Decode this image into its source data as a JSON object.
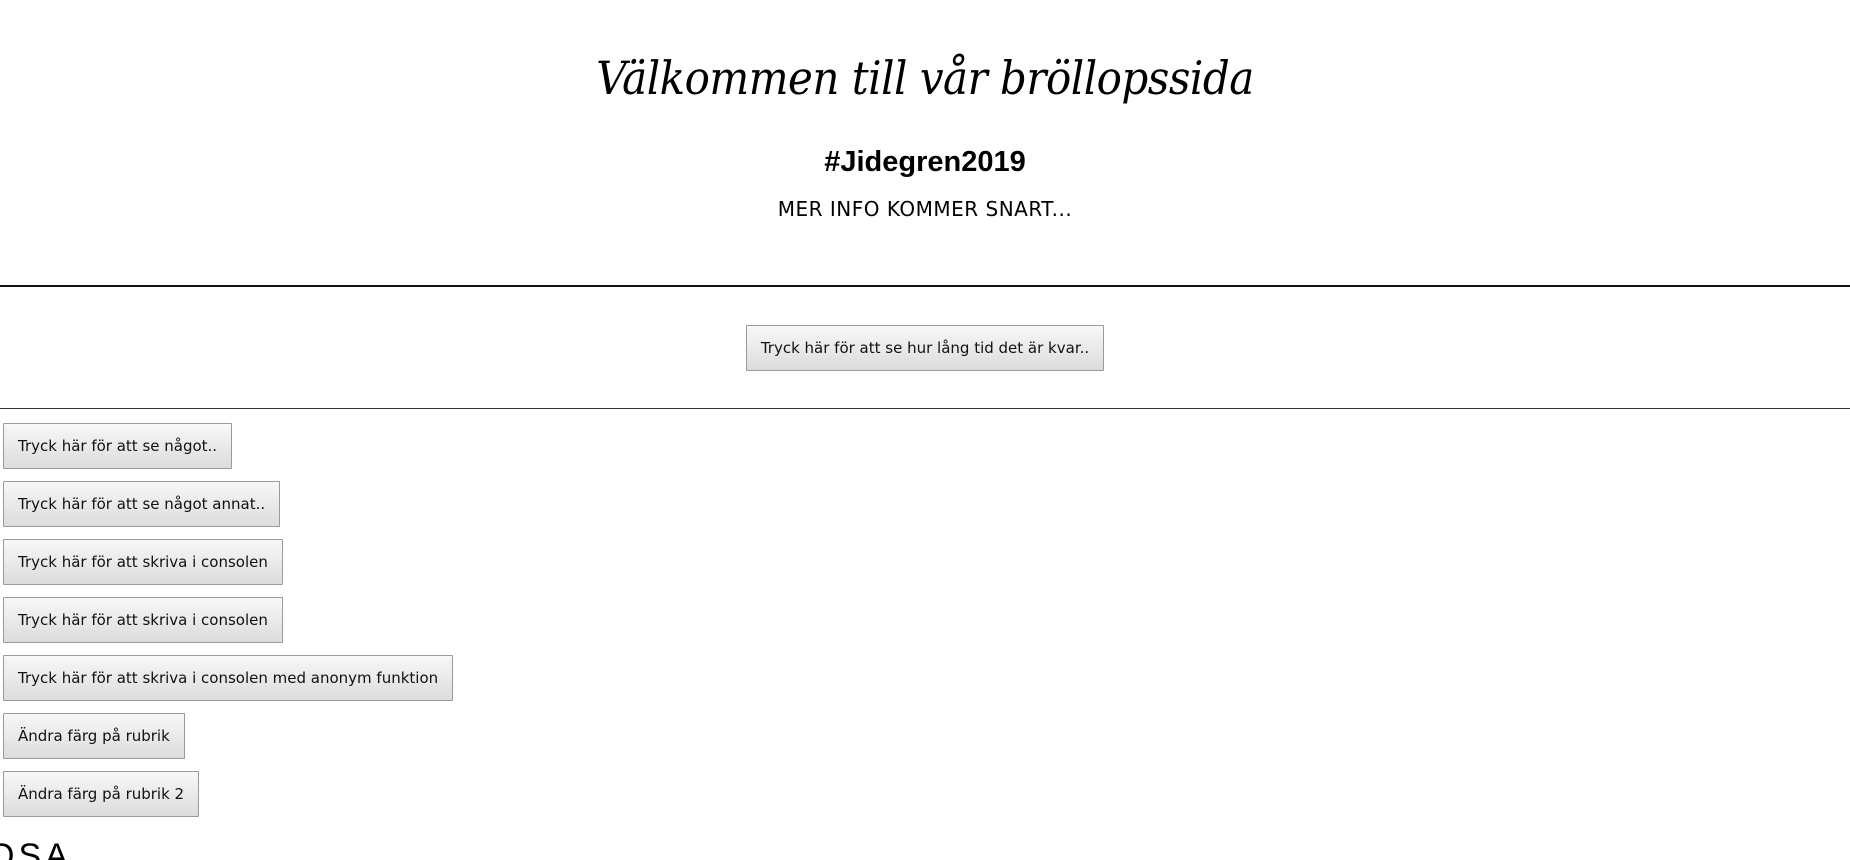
{
  "header": {
    "title": "Välkommen till vår bröllopssida",
    "hashtag": "#Jidegren2019",
    "info": "MER INFO KOMMER SNART..."
  },
  "countdown": {
    "button_label": "Tryck här för att se hur lång tid det är kvar.."
  },
  "buttons": [
    "Tryck här för att se något..",
    "Tryck här för att se något annat..",
    "Tryck här för att skriva i consolen",
    "Tryck här för att skriva i consolen",
    "Tryck här för att skriva i consolen med anonym funktion",
    "Ändra färg på rubrik",
    "Ändra färg på rubrik 2"
  ],
  "partial_heading": "OSA"
}
